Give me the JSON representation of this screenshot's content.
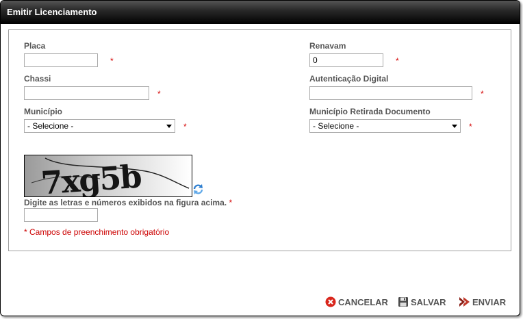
{
  "window": {
    "title": "Emitir Licenciamento"
  },
  "form": {
    "placa": {
      "label": "Placa",
      "value": "",
      "required_mark": "*"
    },
    "renavam": {
      "label": "Renavam",
      "value": "0",
      "required_mark": "*"
    },
    "chassi": {
      "label": "Chassi",
      "value": "",
      "required_mark": "*"
    },
    "autenticacao": {
      "label": "Autenticação Digital",
      "value": "",
      "required_mark": "*"
    },
    "municipio": {
      "label": "Município",
      "selected": "- Selecione -",
      "required_mark": "*"
    },
    "municipio_retirada": {
      "label": "Município Retirada Documento",
      "selected": "- Selecione -",
      "required_mark": "*"
    },
    "captcha": {
      "image_text": "7xg5b",
      "hint": "Digite as letras e números exibidos na figura acima.",
      "required_mark": "*",
      "value": ""
    },
    "required_note": "* Campos de preenchimento obrigatório"
  },
  "actions": {
    "cancel_label": "CANCELAR",
    "save_label": "SALVAR",
    "send_label": "ENVIAR"
  },
  "icons": {
    "cancel": "cancel-icon",
    "save": "floppy-disk-icon",
    "send": "double-arrow-right-icon",
    "refresh": "refresh-icon"
  },
  "colors": {
    "required": "#d40000",
    "titlebar": "#000000",
    "cancel_icon": "#d9261c",
    "send_icon": "#c0392b"
  }
}
